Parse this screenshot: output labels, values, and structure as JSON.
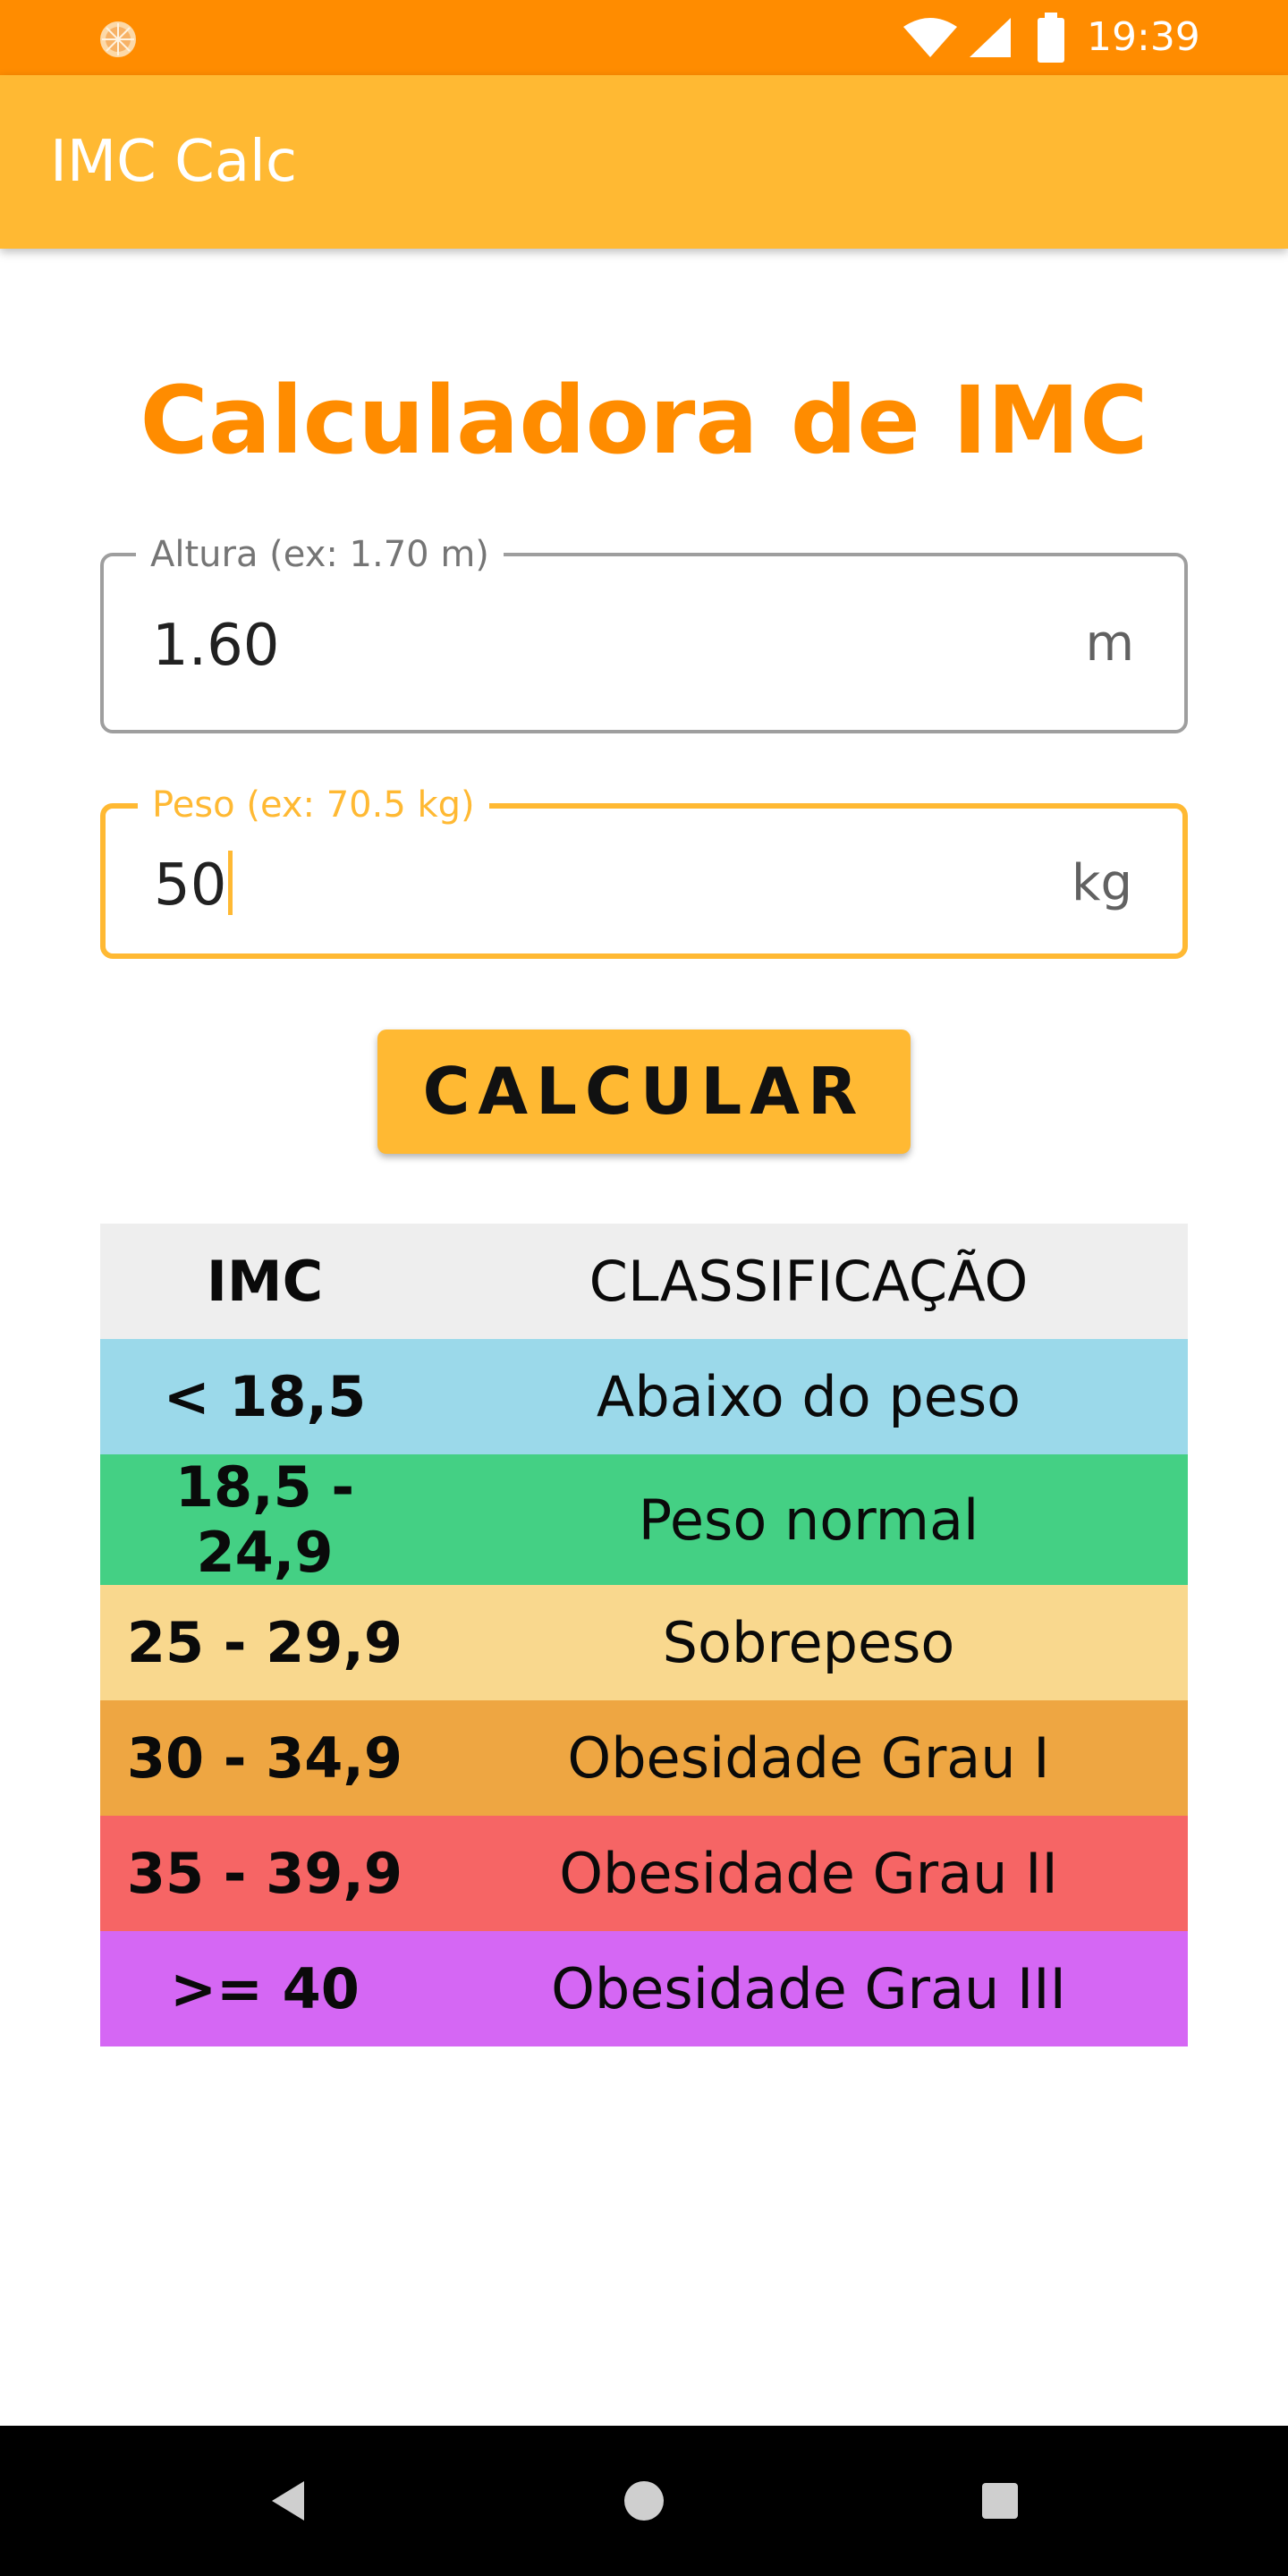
{
  "status_bar": {
    "time": "19:39",
    "icons": [
      "app-notification-icon",
      "wifi-icon",
      "cellular-signal-icon",
      "battery-icon"
    ],
    "color": "#ff8c00"
  },
  "app_bar": {
    "title": "IMC Calc",
    "color": "#ffb933"
  },
  "main": {
    "heading": "Calculadora de IMC",
    "heading_color": "#ff8c00",
    "height_field": {
      "label": "Altura (ex: 1.70 m)",
      "value": "1.60",
      "suffix": "m"
    },
    "weight_field": {
      "label": "Peso (ex: 70.5 kg)",
      "value": "50",
      "suffix": "kg",
      "focused": true
    },
    "calculate_button": "CALCULAR"
  },
  "table": {
    "headers": {
      "imc": "IMC",
      "classification": "CLASSIFICAÇÃO"
    },
    "header_color": "#eeeeee",
    "rows": [
      {
        "imc": "< 18,5",
        "classification": "Abaixo do peso",
        "color": "#9bd9ea"
      },
      {
        "imc": "18,5 - 24,9",
        "classification": "Peso normal",
        "color": "#44d084"
      },
      {
        "imc": "25 - 29,9",
        "classification": "Sobrepeso",
        "color": "#f9d88e"
      },
      {
        "imc": "30 - 34,9",
        "classification": "Obesidade Grau I",
        "color": "#eea642"
      },
      {
        "imc": "35 - 39,9",
        "classification": "Obesidade Grau II",
        "color": "#f66565"
      },
      {
        "imc": ">= 40",
        "classification": "Obesidade Grau III",
        "color": "#d567f4"
      }
    ]
  },
  "nav_bar": {
    "buttons": [
      "back-icon",
      "home-icon",
      "recents-icon"
    ]
  }
}
